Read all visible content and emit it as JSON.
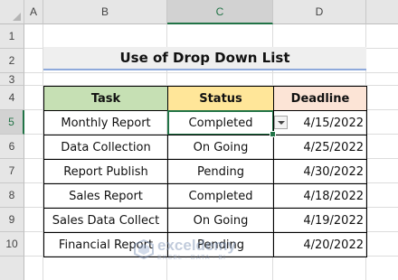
{
  "spreadsheet": {
    "columns": [
      "A",
      "B",
      "C",
      "D"
    ],
    "active_column": "C",
    "rows": [
      "1",
      "2",
      "3",
      "4",
      "5",
      "6",
      "7",
      "8",
      "9",
      "10"
    ],
    "active_row": "5"
  },
  "title": "Use of Drop Down List",
  "table": {
    "headers": [
      "Task",
      "Status",
      "Deadline"
    ],
    "header_colors": [
      "#c6e0b4",
      "#ffe699",
      "#fce4d6"
    ],
    "rows": [
      [
        "Monthly Report",
        "Completed",
        "4/15/2022"
      ],
      [
        "Data Collection",
        "On Going",
        "4/25/2022"
      ],
      [
        "Report Publish",
        "Pending",
        "4/30/2022"
      ],
      [
        "Sales Report",
        "Completed",
        "4/18/2022"
      ],
      [
        "Sales Data Collect",
        "On Going",
        "4/19/2022"
      ],
      [
        "Financial Report",
        "Pending",
        "4/20/2022"
      ]
    ]
  },
  "watermark": {
    "name": "exceldemy",
    "tagline": "EXCEL · DATA · BI"
  }
}
